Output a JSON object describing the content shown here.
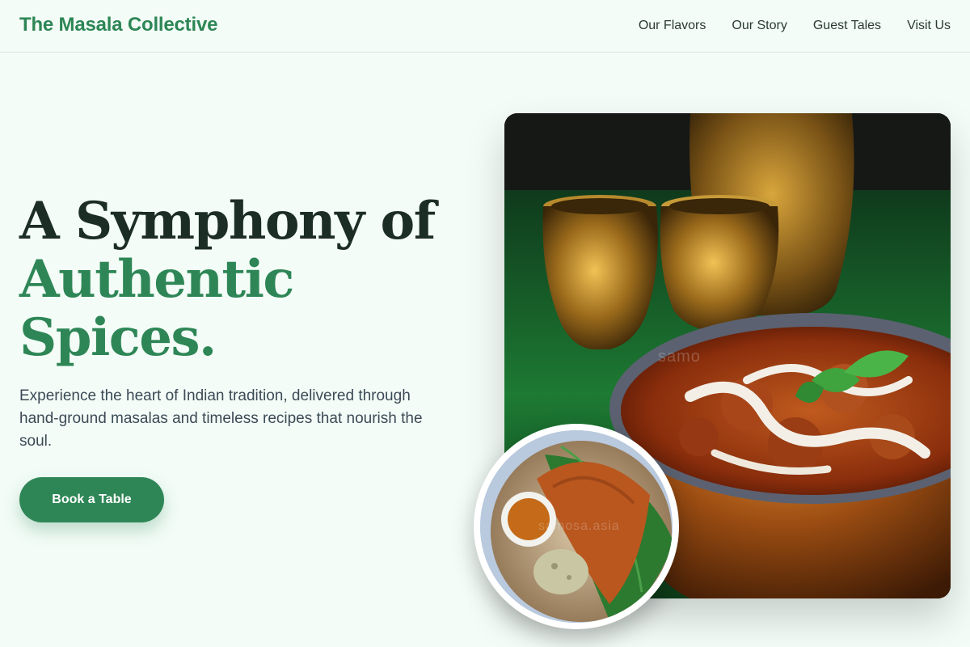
{
  "header": {
    "brand": "The Masala Collective",
    "nav": [
      {
        "label": "Our Flavors"
      },
      {
        "label": "Our Story"
      },
      {
        "label": "Guest Tales"
      },
      {
        "label": "Visit Us"
      }
    ]
  },
  "hero": {
    "title_line1": "A Symphony of",
    "title_accent": "Authentic Spices.",
    "description": "Experience the heart of Indian tradition, delivered through hand-ground masalas and timeless recipes that nourish the soul.",
    "cta_label": "Book a Table"
  },
  "images": {
    "main_alt": "Creamy curry in a copper pot with brass cups on green grass",
    "main_watermark": "samo",
    "thumb_alt": "Dosa on a banana leaf with chutney and sambar",
    "thumb_watermark": "samosa.asia"
  },
  "colors": {
    "accent": "#2e8656",
    "background": "#f3fcf7",
    "heading": "#1c2d25"
  }
}
